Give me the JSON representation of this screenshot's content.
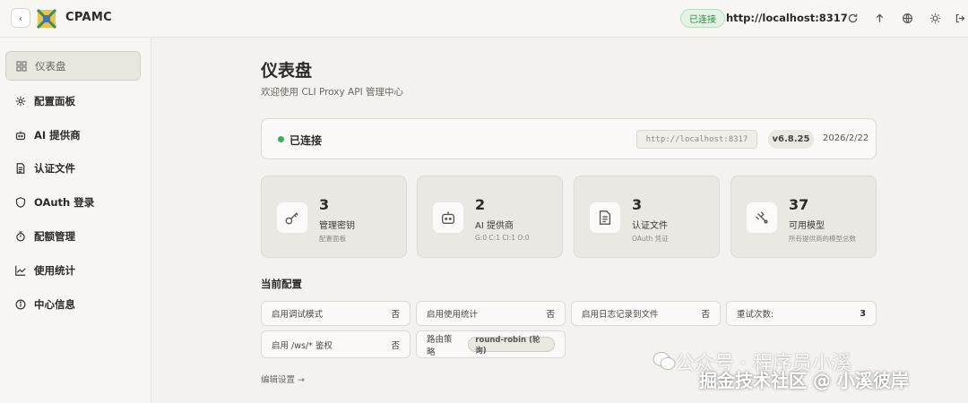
{
  "app": {
    "title": "CPAMC"
  },
  "topbar": {
    "status_badge": "已连接",
    "host": "http://localhost:8317",
    "icons": [
      "refresh-icon",
      "upload-icon",
      "globe-icon",
      "theme-icon",
      "logout-icon"
    ]
  },
  "sidebar": {
    "items": [
      {
        "label": "仪表盘",
        "icon": "dashboard-icon",
        "active": true
      },
      {
        "label": "配置面板",
        "icon": "gear-icon"
      },
      {
        "label": "AI 提供商",
        "icon": "robot-icon"
      },
      {
        "label": "认证文件",
        "icon": "file-icon"
      },
      {
        "label": "OAuth 登录",
        "icon": "shield-icon"
      },
      {
        "label": "配额管理",
        "icon": "timer-icon"
      },
      {
        "label": "使用统计",
        "icon": "chart-icon"
      },
      {
        "label": "中心信息",
        "icon": "info-icon"
      }
    ]
  },
  "main": {
    "title": "仪表盘",
    "subtitle": "欢迎使用 CLI Proxy API 管理中心",
    "status": {
      "text": "已连接",
      "url": "http://localhost:8317",
      "version": "v6.8.25",
      "date": "2026/2/22"
    },
    "stats": [
      {
        "value": "3",
        "label": "管理密钥",
        "sub": "配置面板",
        "icon": "key-icon"
      },
      {
        "value": "2",
        "label": "AI 提供商",
        "sub": "G:0 C:1 Cl:1 O:0",
        "icon": "robot-icon"
      },
      {
        "value": "3",
        "label": "认证文件",
        "sub": "OAuth 凭证",
        "icon": "file-icon"
      },
      {
        "value": "37",
        "label": "可用模型",
        "sub": "所有提供商的模型总数",
        "icon": "model-icon"
      }
    ],
    "config_title": "当前配置",
    "config": [
      {
        "label": "启用调试模式",
        "value": "否"
      },
      {
        "label": "启用使用统计",
        "value": "否"
      },
      {
        "label": "启用日志记录到文件",
        "value": "否"
      },
      {
        "label": "重试次数:",
        "value": "3"
      },
      {
        "label": "启用 /ws/* 鉴权",
        "value": "否"
      },
      {
        "label": "路由策略",
        "value": "round-robin (轮询)"
      }
    ],
    "edit_link": "编辑设置 →"
  },
  "watermark": {
    "line1": "公众号 · 程序员小溪",
    "line2": "掘金技术社区 @ 小溪彼岸"
  },
  "colors": {
    "connected": "#3fae5c",
    "badge_bg": "#e4f3e6"
  }
}
